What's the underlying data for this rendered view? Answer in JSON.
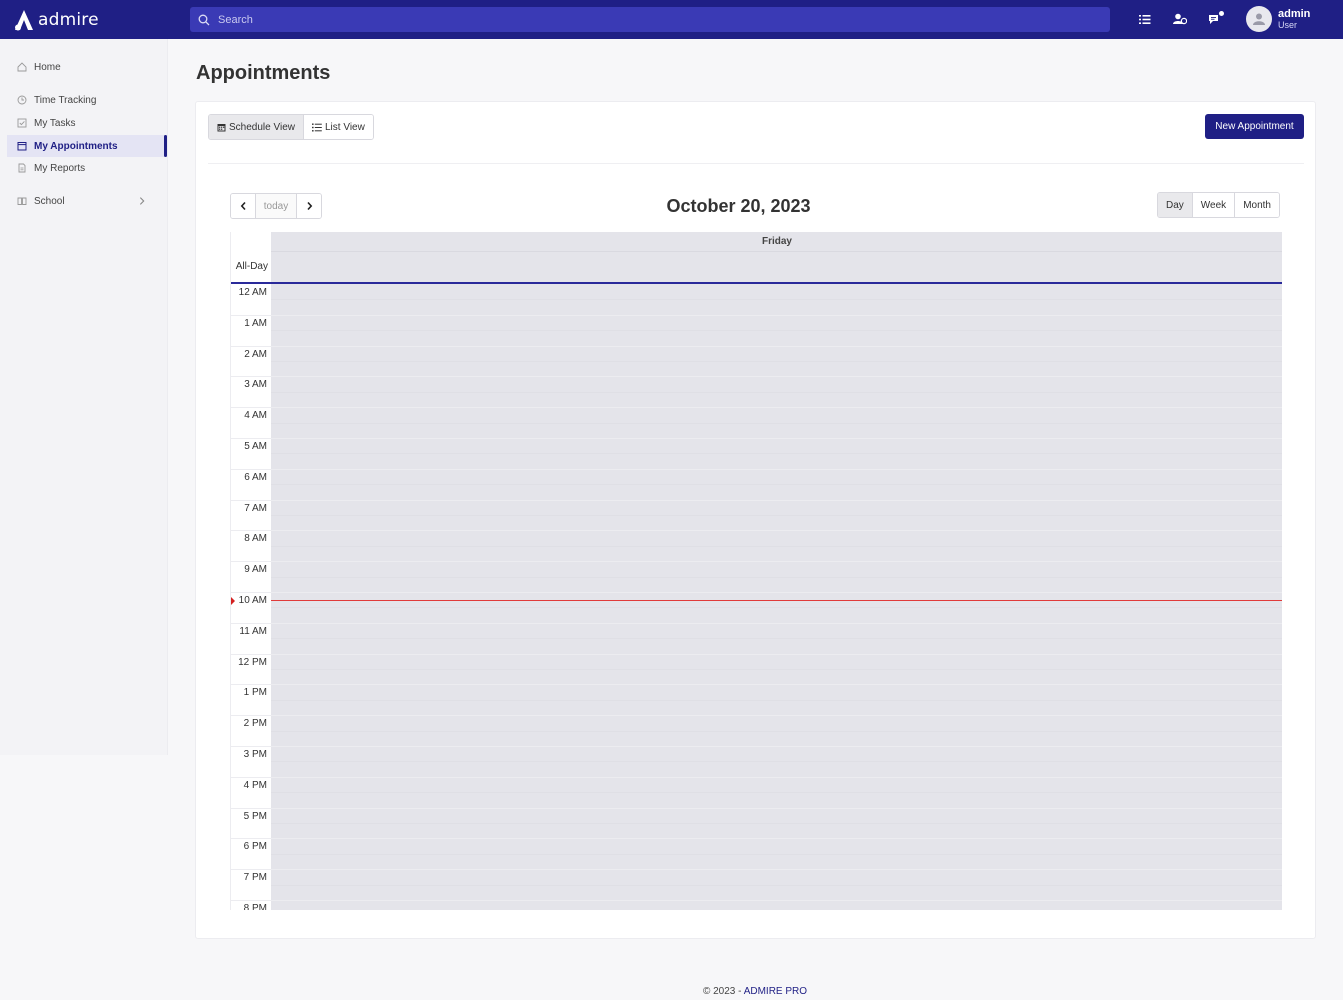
{
  "brand": {
    "name": "admire"
  },
  "search": {
    "placeholder": "Search"
  },
  "user": {
    "name": "admin",
    "role": "User"
  },
  "sidebar": {
    "items": [
      {
        "label": "Home",
        "icon": "home-icon"
      },
      {
        "label": "Time Tracking",
        "icon": "clock-icon"
      },
      {
        "label": "My Tasks",
        "icon": "checkbox-icon"
      },
      {
        "label": "My Appointments",
        "icon": "calendar-icon",
        "active": true
      },
      {
        "label": "My Reports",
        "icon": "document-icon"
      },
      {
        "label": "School",
        "icon": "book-icon"
      }
    ]
  },
  "page": {
    "title": "Appointments"
  },
  "toolbar": {
    "schedule_view": "Schedule View",
    "list_view": "List View",
    "new_appointment": "New Appointment"
  },
  "calendar": {
    "today_label": "today",
    "title": "October 20, 2023",
    "ranges": [
      "Day",
      "Week",
      "Month"
    ],
    "active_range": "Day",
    "day_header": "Friday",
    "all_day_label": "All-Day",
    "hours": [
      "12 AM",
      "1 AM",
      "2 AM",
      "3 AM",
      "4 AM",
      "5 AM",
      "6 AM",
      "7 AM",
      "8 AM",
      "9 AM",
      "10 AM",
      "11 AM",
      "12 PM",
      "1 PM",
      "2 PM",
      "3 PM",
      "4 PM",
      "5 PM",
      "6 PM",
      "7 PM",
      "8 PM"
    ]
  },
  "footer": {
    "prefix": "© 2023 - ",
    "brand": "ADMIRE PRO"
  },
  "colors": {
    "primary": "#1f1f85",
    "now_indicator": "#e03a3a"
  }
}
